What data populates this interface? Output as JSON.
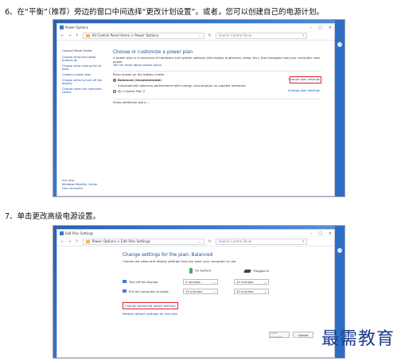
{
  "steps": {
    "step6": "6、在“平衡”（推荐）旁边的窗口中间选择“更改计划设置”。或者，您可以创建自己的电源计划。",
    "step7": "7、单击更改高级电源设置。"
  },
  "shot1": {
    "title": "Power Options",
    "breadcrumb": "All Control Panel Items  >  Power Options",
    "search_placeholder": "Search Control Panel",
    "sidebar": {
      "title": "Control Panel Home",
      "items": [
        "Choose what the power buttons do",
        "Choose what closing the lid does",
        "Create a power plan",
        "Choose when to turn off the display",
        "Change when the computer sleeps"
      ],
      "see_also": "See also",
      "see_also_items": [
        "Windows Mobility Center",
        "User Accounts"
      ]
    },
    "main": {
      "heading": "Choose or customize a power plan",
      "desc": "A power plan is a collection of hardware and system settings (like display brightness, sleep, etc.) that manages how your computer uses power.",
      "desc_link": "Tell me more about power plans",
      "plans_label": "Plans shown on the battery meter",
      "plan1_name": "Balanced (recommended)",
      "plan1_desc": "Automatically balances performance with energy consumption on capable hardware.",
      "plan2_name": "My Custom Plan 2",
      "change_link": "Change plan settings",
      "show_more": "Show additional plans"
    }
  },
  "shot2": {
    "title": "Edit Plan Settings",
    "breadcrumb": "Power Options  >  Edit Plan Settings",
    "search_placeholder": "Search Control Panel",
    "heading": "Change settings for the plan: Balanced",
    "subheading": "Choose the sleep and display settings that you want your computer to use.",
    "col_battery": "On battery",
    "col_plugged": "Plugged in",
    "rows": [
      {
        "label": "Turn off the display:",
        "battery": "3 minutes",
        "plugged": "10 minutes"
      },
      {
        "label": "Put the computer to sleep:",
        "battery": "15 minutes",
        "plugged": "30 minutes"
      }
    ],
    "advanced_link": "Change advanced power settings",
    "restore_link": "Restore default settings for this plan",
    "save_button": "Save changes",
    "cancel_button": "Cancel"
  },
  "watermark": "最需教育"
}
